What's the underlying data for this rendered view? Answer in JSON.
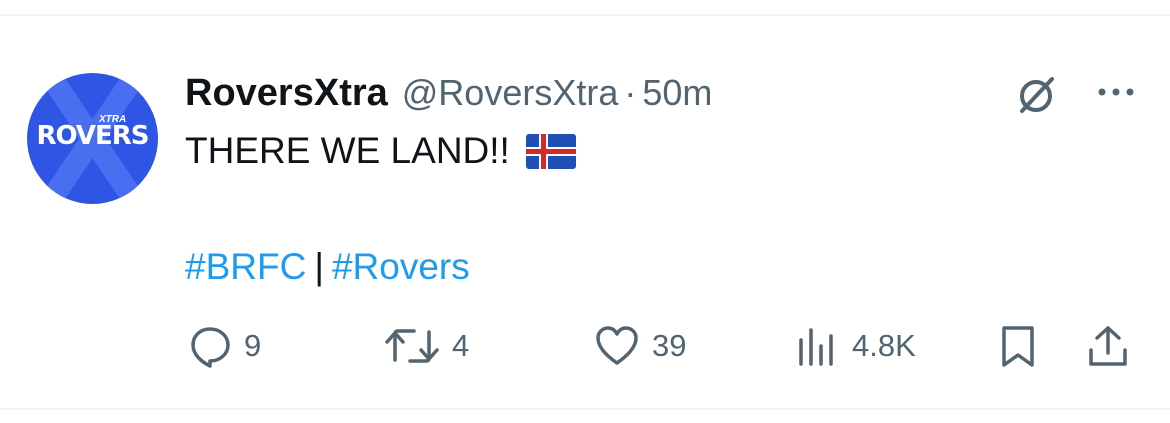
{
  "tweet": {
    "author": {
      "display_name": "RoversXtra",
      "handle": "@RoversXtra",
      "avatar_text": "ROVERS",
      "avatar_subtext": "XTRA",
      "avatar_color": "#2f55e4"
    },
    "separator": "·",
    "time": "50m",
    "text": "THERE WE LAND!!",
    "flag_icon": "iceland-flag-icon",
    "hashtags": [
      "#BRFC",
      "#Rovers"
    ],
    "hashtag_separator": "|",
    "hashtag_color": "#1d9bf0"
  },
  "actions": {
    "replies": "9",
    "retweets": "4",
    "likes": "39",
    "views": "4.8K"
  },
  "icons": {
    "grok": "grok-icon",
    "more": "more-options-icon",
    "reply": "reply-icon",
    "retweet": "retweet-icon",
    "like": "heart-icon",
    "views": "views-icon",
    "bookmark": "bookmark-icon",
    "share": "share-icon"
  }
}
